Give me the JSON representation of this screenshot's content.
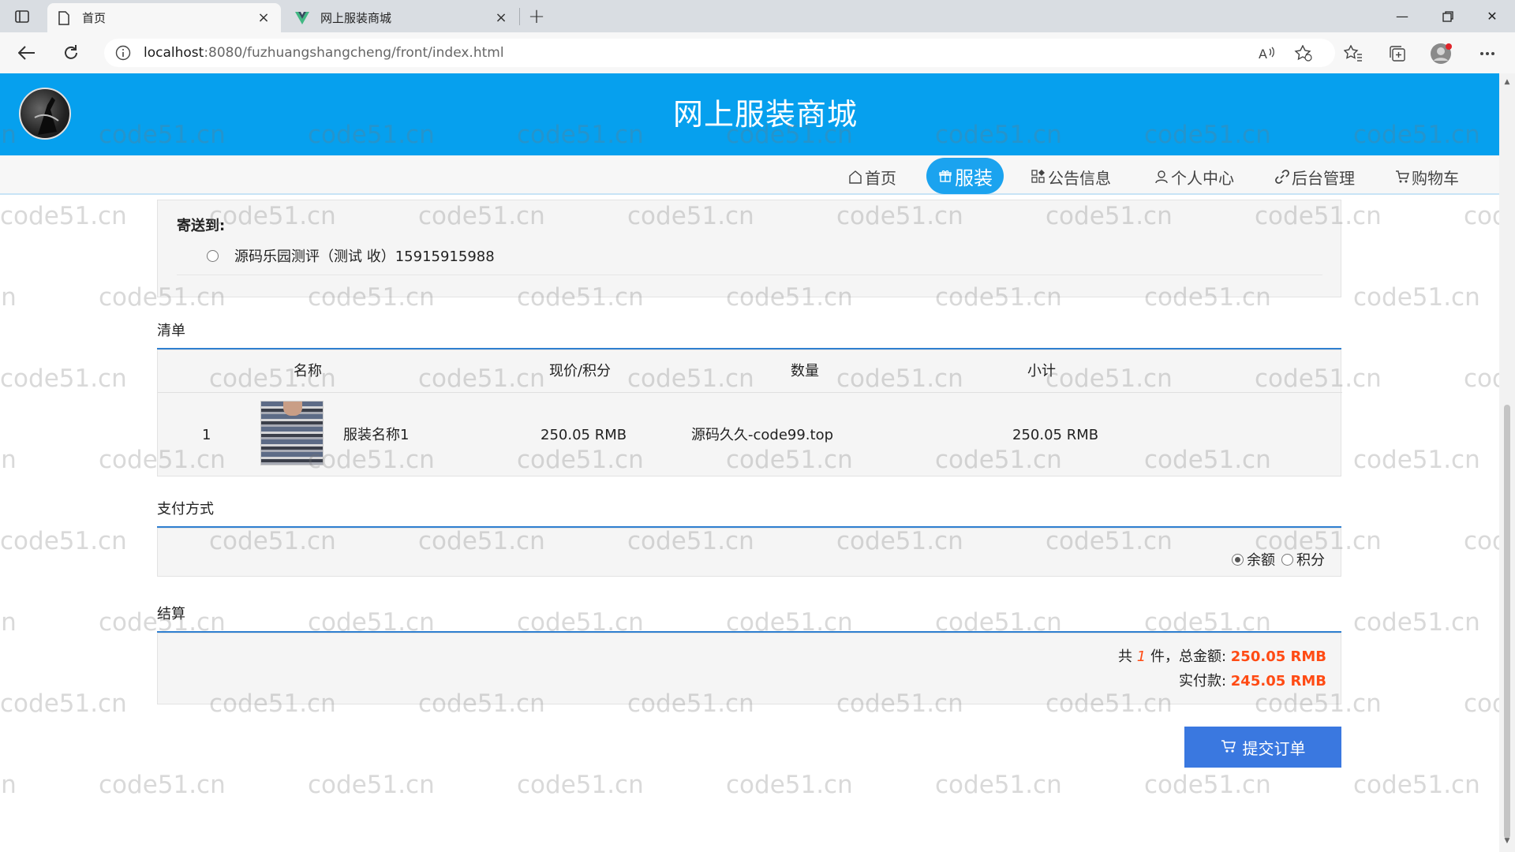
{
  "browser": {
    "tabs": [
      {
        "title": "首页",
        "active": true
      },
      {
        "title": "网上服装商城",
        "active": false
      }
    ],
    "url_host": "localhost",
    "url_rest": ":8080/fuzhuangshangcheng/front/index.html"
  },
  "site": {
    "title": "网上服装商城"
  },
  "nav": {
    "items": [
      {
        "label": "首页",
        "icon": "home-icon"
      },
      {
        "label": "服装",
        "icon": "gift-icon",
        "active": true
      },
      {
        "label": "公告信息",
        "icon": "grid-icon"
      },
      {
        "label": "个人中心",
        "icon": "user-icon"
      },
      {
        "label": "后台管理",
        "icon": "link-icon"
      },
      {
        "label": "购物车",
        "icon": "cart-icon"
      }
    ]
  },
  "shipping": {
    "title": "寄送到:",
    "address": "源码乐园测评（测试 收）15915915988"
  },
  "list": {
    "title": "清单",
    "headers": [
      "名称",
      "现价/积分",
      "数量",
      "小计"
    ],
    "rows": [
      {
        "index": "1",
        "name": "服装名称1",
        "price": "250.05 RMB",
        "qty": "源码久久-code99.top",
        "subtotal": "250.05 RMB"
      }
    ]
  },
  "payment": {
    "title": "支付方式",
    "options": [
      {
        "label": "余额",
        "selected": true
      },
      {
        "label": "积分",
        "selected": false
      }
    ]
  },
  "checkout": {
    "title": "结算",
    "prefix": "共",
    "count": "1",
    "count_suffix": "件，总金额:",
    "total": "250.05 RMB",
    "paid_label": "实付款:",
    "paid": "245.05 RMB"
  },
  "submit": {
    "label": "提交订单"
  },
  "watermark": "code51.cn",
  "colors": {
    "header": "#06a0ee",
    "accent_blue": "#3a78e0",
    "price_red": "#ff4b14"
  }
}
